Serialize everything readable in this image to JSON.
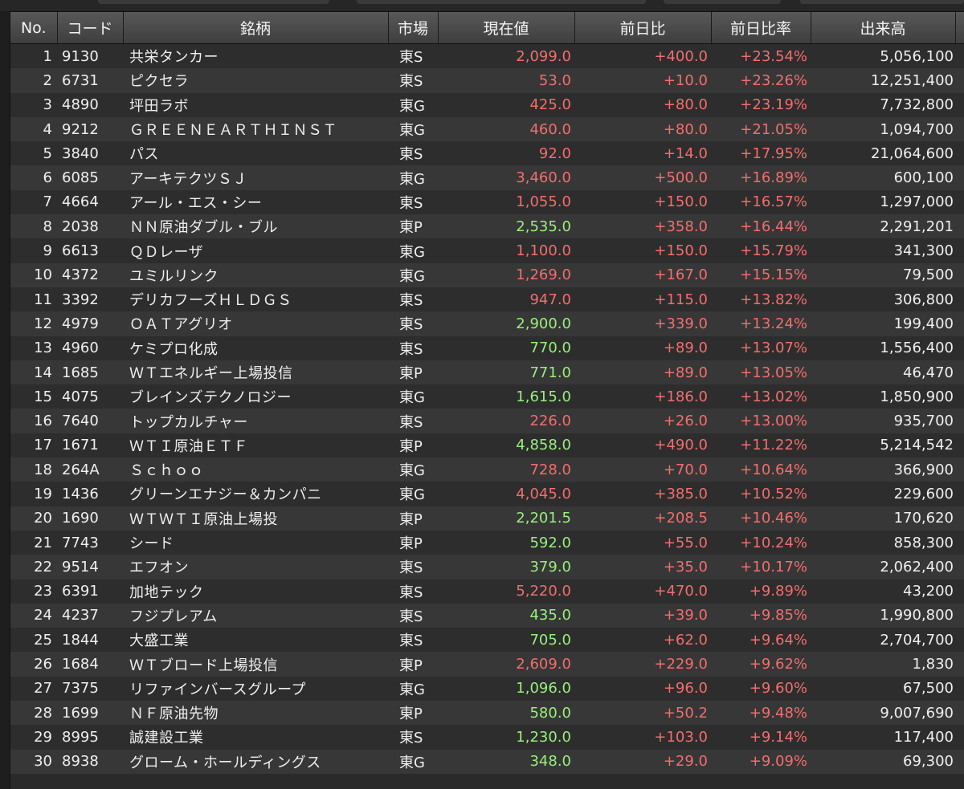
{
  "headers": {
    "no": "No.",
    "code": "コード",
    "name": "銘柄",
    "market": "市場",
    "price": "現在値",
    "change": "前日比",
    "change_pct": "前日比率",
    "volume": "出来高"
  },
  "colors": {
    "down_or_red": "#f36d6d",
    "green": "#98f07d"
  },
  "rows": [
    {
      "no": "1",
      "code": "9130",
      "name": "共栄タンカー",
      "market": "東S",
      "price": "2,099.0",
      "price_color": "red",
      "change": "+400.0",
      "change_pct": "+23.54%",
      "volume": "5,056,100"
    },
    {
      "no": "2",
      "code": "6731",
      "name": "ピクセラ",
      "market": "東S",
      "price": "53.0",
      "price_color": "red",
      "change": "+10.0",
      "change_pct": "+23.26%",
      "volume": "12,251,400"
    },
    {
      "no": "3",
      "code": "4890",
      "name": "坪田ラボ",
      "market": "東G",
      "price": "425.0",
      "price_color": "red",
      "change": "+80.0",
      "change_pct": "+23.19%",
      "volume": "7,732,800"
    },
    {
      "no": "4",
      "code": "9212",
      "name": "ＧＲＥＥＮＥＡＲＴＨＩＮＳＴ",
      "market": "東G",
      "price": "460.0",
      "price_color": "red",
      "change": "+80.0",
      "change_pct": "+21.05%",
      "volume": "1,094,700"
    },
    {
      "no": "5",
      "code": "3840",
      "name": "パス",
      "market": "東S",
      "price": "92.0",
      "price_color": "red",
      "change": "+14.0",
      "change_pct": "+17.95%",
      "volume": "21,064,600"
    },
    {
      "no": "6",
      "code": "6085",
      "name": "アーキテクツＳＪ",
      "market": "東G",
      "price": "3,460.0",
      "price_color": "red",
      "change": "+500.0",
      "change_pct": "+16.89%",
      "volume": "600,100"
    },
    {
      "no": "7",
      "code": "4664",
      "name": "アール・エス・シー",
      "market": "東S",
      "price": "1,055.0",
      "price_color": "red",
      "change": "+150.0",
      "change_pct": "+16.57%",
      "volume": "1,297,000"
    },
    {
      "no": "8",
      "code": "2038",
      "name": "ＮＮ原油ダブル・ブル",
      "market": "東P",
      "price": "2,535.0",
      "price_color": "green",
      "change": "+358.0",
      "change_pct": "+16.44%",
      "volume": "2,291,201"
    },
    {
      "no": "9",
      "code": "6613",
      "name": "ＱＤレーザ",
      "market": "東G",
      "price": "1,100.0",
      "price_color": "red",
      "change": "+150.0",
      "change_pct": "+15.79%",
      "volume": "341,300"
    },
    {
      "no": "10",
      "code": "4372",
      "name": "ユミルリンク",
      "market": "東G",
      "price": "1,269.0",
      "price_color": "red",
      "change": "+167.0",
      "change_pct": "+15.15%",
      "volume": "79,500"
    },
    {
      "no": "11",
      "code": "3392",
      "name": "デリカフーズＨＬＤＧＳ",
      "market": "東S",
      "price": "947.0",
      "price_color": "red",
      "change": "+115.0",
      "change_pct": "+13.82%",
      "volume": "306,800"
    },
    {
      "no": "12",
      "code": "4979",
      "name": "ＯＡＴアグリオ",
      "market": "東S",
      "price": "2,900.0",
      "price_color": "green",
      "change": "+339.0",
      "change_pct": "+13.24%",
      "volume": "199,400"
    },
    {
      "no": "13",
      "code": "4960",
      "name": "ケミプロ化成",
      "market": "東S",
      "price": "770.0",
      "price_color": "green",
      "change": "+89.0",
      "change_pct": "+13.07%",
      "volume": "1,556,400"
    },
    {
      "no": "14",
      "code": "1685",
      "name": "ＷＴエネルギー上場投信",
      "market": "東P",
      "price": "771.0",
      "price_color": "green",
      "change": "+89.0",
      "change_pct": "+13.05%",
      "volume": "46,470"
    },
    {
      "no": "15",
      "code": "4075",
      "name": "ブレインズテクノロジー",
      "market": "東G",
      "price": "1,615.0",
      "price_color": "green",
      "change": "+186.0",
      "change_pct": "+13.02%",
      "volume": "1,850,900"
    },
    {
      "no": "16",
      "code": "7640",
      "name": "トップカルチャー",
      "market": "東S",
      "price": "226.0",
      "price_color": "red",
      "change": "+26.0",
      "change_pct": "+13.00%",
      "volume": "935,700"
    },
    {
      "no": "17",
      "code": "1671",
      "name": "ＷＴＩ原油ＥＴＦ",
      "market": "東P",
      "price": "4,858.0",
      "price_color": "green",
      "change": "+490.0",
      "change_pct": "+11.22%",
      "volume": "5,214,542"
    },
    {
      "no": "18",
      "code": "264A",
      "name": "Ｓｃｈｏｏ",
      "market": "東G",
      "price": "728.0",
      "price_color": "red",
      "change": "+70.0",
      "change_pct": "+10.64%",
      "volume": "366,900"
    },
    {
      "no": "19",
      "code": "1436",
      "name": "グリーンエナジー＆カンパニ",
      "market": "東G",
      "price": "4,045.0",
      "price_color": "red",
      "change": "+385.0",
      "change_pct": "+10.52%",
      "volume": "229,600"
    },
    {
      "no": "20",
      "code": "1690",
      "name": "ＷＴＷＴＩ原油上場投",
      "market": "東P",
      "price": "2,201.5",
      "price_color": "green",
      "change": "+208.5",
      "change_pct": "+10.46%",
      "volume": "170,620"
    },
    {
      "no": "21",
      "code": "7743",
      "name": "シード",
      "market": "東P",
      "price": "592.0",
      "price_color": "green",
      "change": "+55.0",
      "change_pct": "+10.24%",
      "volume": "858,300"
    },
    {
      "no": "22",
      "code": "9514",
      "name": "エフオン",
      "market": "東S",
      "price": "379.0",
      "price_color": "green",
      "change": "+35.0",
      "change_pct": "+10.17%",
      "volume": "2,062,400"
    },
    {
      "no": "23",
      "code": "6391",
      "name": "加地テック",
      "market": "東S",
      "price": "5,220.0",
      "price_color": "red",
      "change": "+470.0",
      "change_pct": "+9.89%",
      "volume": "43,200"
    },
    {
      "no": "24",
      "code": "4237",
      "name": "フジプレアム",
      "market": "東S",
      "price": "435.0",
      "price_color": "green",
      "change": "+39.0",
      "change_pct": "+9.85%",
      "volume": "1,990,800"
    },
    {
      "no": "25",
      "code": "1844",
      "name": "大盛工業",
      "market": "東S",
      "price": "705.0",
      "price_color": "green",
      "change": "+62.0",
      "change_pct": "+9.64%",
      "volume": "2,704,700"
    },
    {
      "no": "26",
      "code": "1684",
      "name": "ＷＴブロード上場投信",
      "market": "東P",
      "price": "2,609.0",
      "price_color": "red",
      "change": "+229.0",
      "change_pct": "+9.62%",
      "volume": "1,830"
    },
    {
      "no": "27",
      "code": "7375",
      "name": "リファインバースグループ",
      "market": "東G",
      "price": "1,096.0",
      "price_color": "green",
      "change": "+96.0",
      "change_pct": "+9.60%",
      "volume": "67,500"
    },
    {
      "no": "28",
      "code": "1699",
      "name": "ＮＦ原油先物",
      "market": "東P",
      "price": "580.0",
      "price_color": "green",
      "change": "+50.2",
      "change_pct": "+9.48%",
      "volume": "9,007,690"
    },
    {
      "no": "29",
      "code": "8995",
      "name": "誠建設工業",
      "market": "東S",
      "price": "1,230.0",
      "price_color": "green",
      "change": "+103.0",
      "change_pct": "+9.14%",
      "volume": "117,400"
    },
    {
      "no": "30",
      "code": "8938",
      "name": "グローム・ホールディングス",
      "market": "東G",
      "price": "348.0",
      "price_color": "green",
      "change": "+29.0",
      "change_pct": "+9.09%",
      "volume": "69,300"
    }
  ]
}
